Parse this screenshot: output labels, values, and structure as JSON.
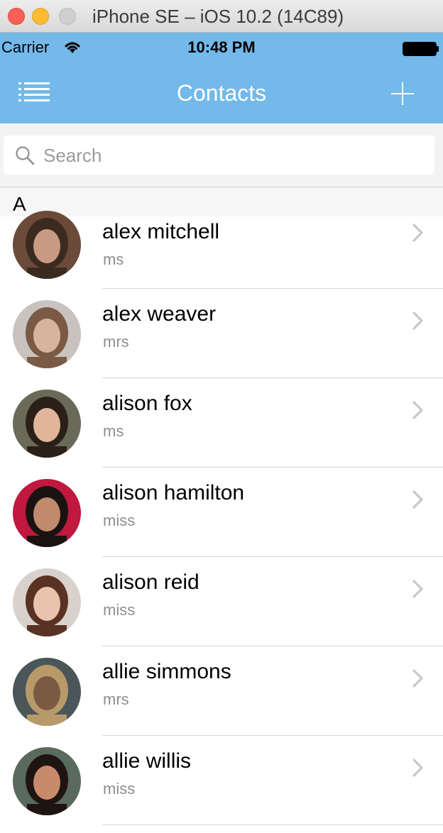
{
  "window": {
    "title": "iPhone SE – iOS 10.2 (14C89)"
  },
  "status_bar": {
    "carrier": "Carrier",
    "time": "10:48 PM"
  },
  "nav": {
    "title": "Contacts",
    "menu_icon": "menu-icon",
    "add_icon": "plus-icon"
  },
  "search": {
    "placeholder": "Search",
    "value": ""
  },
  "section": {
    "letter": "A"
  },
  "colors": {
    "nav_bg": "#73b9ea",
    "nav_text": "#ffffff",
    "subtitle": "#8e8e93",
    "chevron": "#c7c7cc"
  },
  "contacts": [
    {
      "name": "alex mitchell",
      "title": "ms",
      "avatar_colors": [
        "#6b4a3a",
        "#c99a82",
        "#3b2a20"
      ]
    },
    {
      "name": "alex weaver",
      "title": "mrs",
      "avatar_colors": [
        "#c8c3bf",
        "#d9b49c",
        "#7a5a45"
      ]
    },
    {
      "name": "alison fox",
      "title": "ms",
      "avatar_colors": [
        "#6a6a58",
        "#e0b59a",
        "#2a2018"
      ]
    },
    {
      "name": "alison hamilton",
      "title": "miss",
      "avatar_colors": [
        "#c0183e",
        "#c08a6c",
        "#1a1210"
      ]
    },
    {
      "name": "alison reid",
      "title": "miss",
      "avatar_colors": [
        "#d9d2cc",
        "#eac3ae",
        "#5a3224"
      ]
    },
    {
      "name": "allie simmons",
      "title": "mrs",
      "avatar_colors": [
        "#4a5658",
        "#7b5a44",
        "#b89a6a"
      ]
    },
    {
      "name": "allie willis",
      "title": "miss",
      "avatar_colors": [
        "#5a6a5c",
        "#c98a6c",
        "#1e1410"
      ]
    }
  ]
}
